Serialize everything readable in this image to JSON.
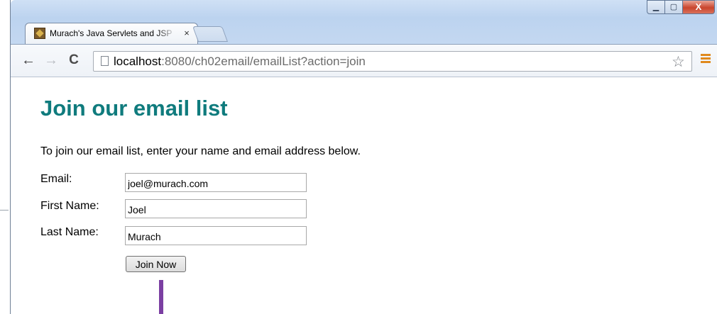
{
  "browser": {
    "tab": {
      "title": "Murach's Java Servlets and JSP",
      "close_glyph": "×",
      "favicon": "murach-logo-icon"
    },
    "window_controls": {
      "minimize": "▁",
      "maximize": "▢",
      "close": "X"
    },
    "toolbar": {
      "back_glyph": "←",
      "forward_glyph": "→",
      "reload_glyph": "C",
      "url_host": "localhost",
      "url_rest": ":8080/ch02email/emailList?action=join",
      "bookmark_glyph": "☆"
    }
  },
  "page": {
    "heading": "Join our email list",
    "intro": "To join our email list, enter your name and email address below.",
    "form": {
      "email_label": "Email:",
      "email_value": "joel@murach.com",
      "first_name_label": "First Name:",
      "first_name_value": "Joel",
      "last_name_label": "Last Name:",
      "last_name_value": "Murach",
      "submit_label": "Join Now"
    }
  },
  "colors": {
    "heading": "#0f7b7d",
    "annotation_line": "#7b3fa2",
    "menu_accent": "#e08a1e"
  }
}
